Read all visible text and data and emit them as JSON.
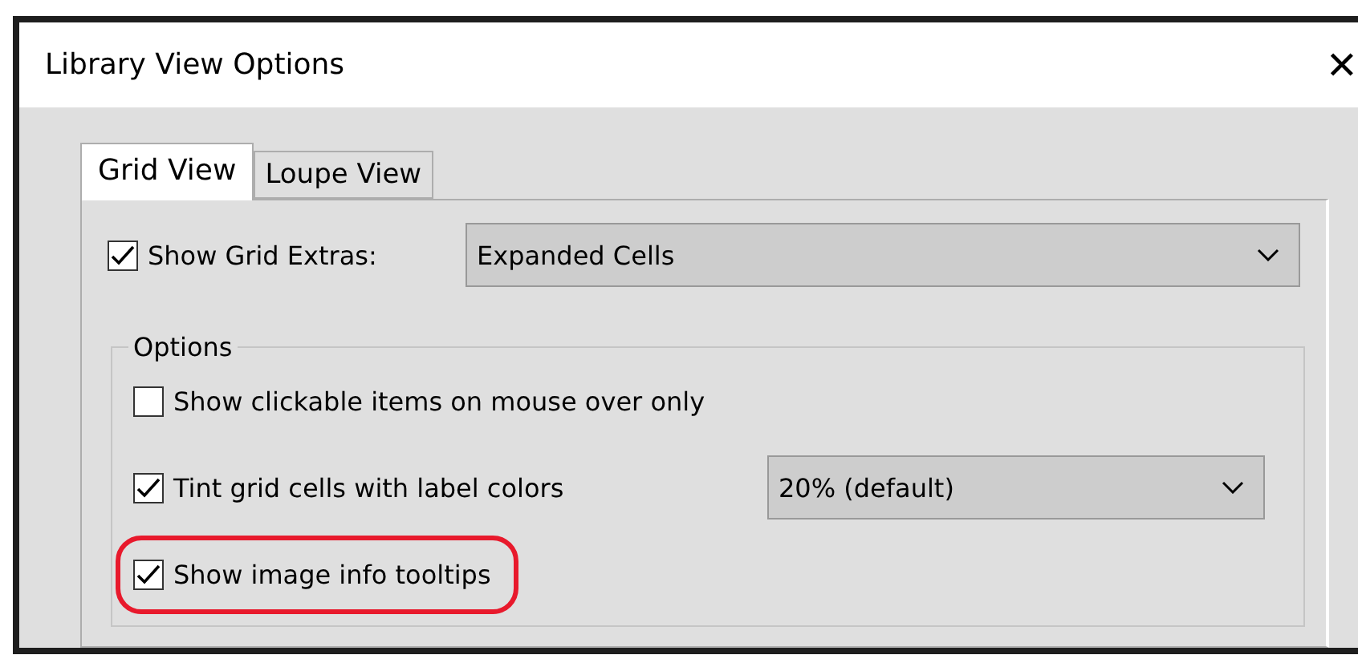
{
  "window": {
    "title": "Library View Options",
    "close": "✕"
  },
  "tabs": [
    {
      "label": "Grid View",
      "selected": true
    },
    {
      "label": "Loupe View",
      "selected": false
    }
  ],
  "grid_extras": {
    "label": "Show Grid Extras:",
    "checked": true,
    "value": "Expanded Cells"
  },
  "options_group": {
    "title": "Options",
    "items": [
      {
        "label": "Show clickable items on mouse over only",
        "checked": false,
        "highlighted": false
      },
      {
        "label": "Tint grid cells with label colors",
        "checked": true,
        "highlighted": false,
        "dropdown": "20% (default)"
      },
      {
        "label": "Show image info tooltips",
        "checked": true,
        "highlighted": true
      }
    ]
  }
}
